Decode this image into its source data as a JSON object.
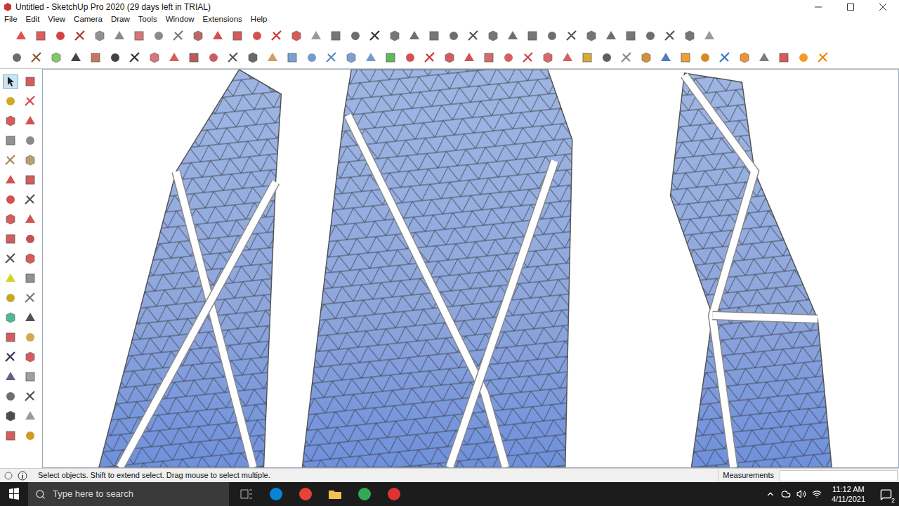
{
  "window": {
    "title": "Untitled - SketchUp Pro 2020 (29 days left in TRIAL)"
  },
  "menu": [
    "File",
    "Edit",
    "View",
    "Camera",
    "Draw",
    "Tools",
    "Window",
    "Extensions",
    "Help"
  ],
  "palette": {
    "select_tool_selected": true
  },
  "status_bar": {
    "hint": "Select objects. Shift to extend select. Drag mouse to select multiple.",
    "measurements_label": "Measurements",
    "measurements_value": ""
  },
  "taskbar": {
    "search_placeholder": "Type here to search",
    "time": "11:12 AM",
    "date": "4/11/2021",
    "notifications": "2"
  }
}
